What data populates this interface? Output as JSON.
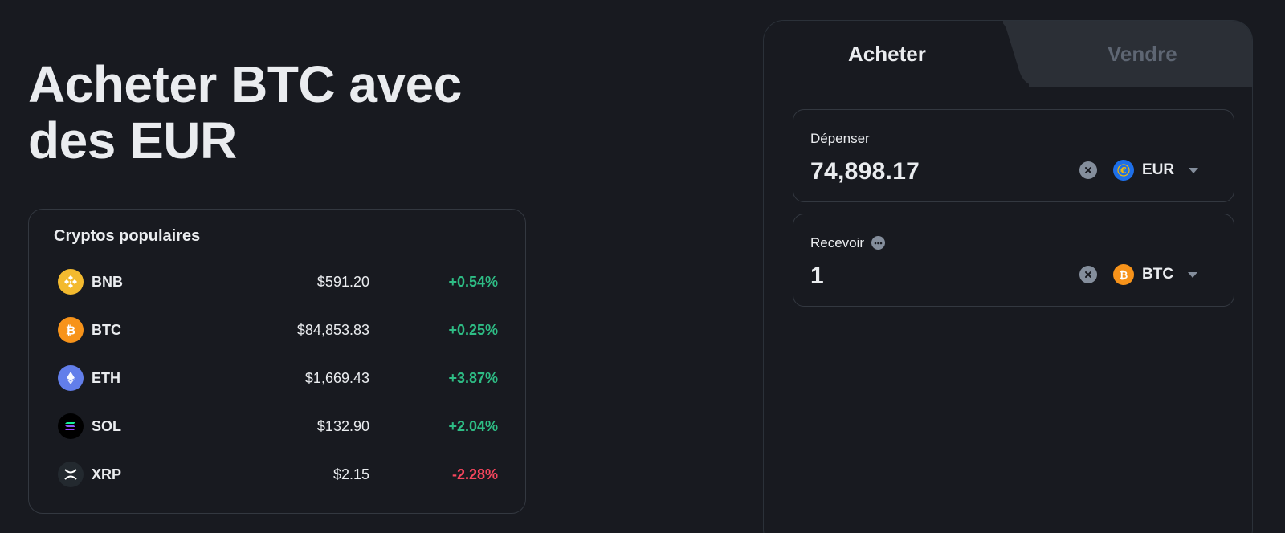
{
  "headline": "Acheter BTC avec des EUR",
  "popular": {
    "title": "Cryptos populaires",
    "rows": [
      {
        "symbol": "BNB",
        "price": "$591.20",
        "change": "+0.54%",
        "direction": "up",
        "icon": "bnb-icon",
        "color": "#f3ba2f"
      },
      {
        "symbol": "BTC",
        "price": "$84,853.83",
        "change": "+0.25%",
        "direction": "up",
        "icon": "btc-icon",
        "color": "#f7931a"
      },
      {
        "symbol": "ETH",
        "price": "$1,669.43",
        "change": "+3.87%",
        "direction": "up",
        "icon": "eth-icon",
        "color": "#627eea"
      },
      {
        "symbol": "SOL",
        "price": "$132.90",
        "change": "+2.04%",
        "direction": "up",
        "icon": "sol-icon",
        "color": "#000000"
      },
      {
        "symbol": "XRP",
        "price": "$2.15",
        "change": "-2.28%",
        "direction": "down",
        "icon": "xrp-icon",
        "color": "#23292f"
      }
    ]
  },
  "trade": {
    "tabs": {
      "buy": "Acheter",
      "sell": "Vendre",
      "active": "buy"
    },
    "spend": {
      "label": "Dépenser",
      "value": "74,898.17",
      "currency": "EUR",
      "icon": "eur-icon"
    },
    "receive": {
      "label": "Recevoir",
      "value": "1",
      "currency": "BTC",
      "icon": "btc-icon"
    }
  },
  "colors": {
    "background": "#181a20",
    "up": "#2ebd85",
    "down": "#f6465d",
    "inactive_tab": "#2b2f36",
    "border": "#333840"
  }
}
